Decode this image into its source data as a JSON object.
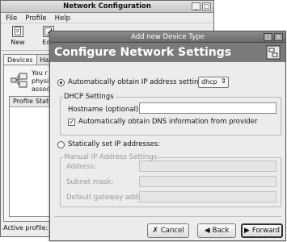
{
  "back_window": {
    "title": "Network Configuration",
    "menu": [
      "File",
      "Profile",
      "Help"
    ],
    "toolbar": [
      {
        "label": "New",
        "icon": "new-icon"
      },
      {
        "label": "Edit",
        "icon": "edit-icon"
      }
    ],
    "tabs": [
      "Devices",
      "Hardw"
    ],
    "info_text": [
      "You r",
      "physi",
      "assoc"
    ],
    "table_headers": [
      "Profile",
      "Status"
    ],
    "status_text": "Active profile: Co"
  },
  "dialog": {
    "window_title": "Add new Device Type",
    "heading": "Configure Network Settings",
    "auto_option": {
      "label": "Automatically obtain IP address settings with:",
      "selected": true
    },
    "protocol_select": {
      "value": "dhcp"
    },
    "dhcp_group": {
      "title": "DHCP Settings",
      "hostname_label": "Hostname (optional):",
      "hostname_value": "",
      "dns_checkbox_label": "Automatically obtain DNS information from provider",
      "dns_checked": true
    },
    "static_option": {
      "label": "Statically set IP addresses:",
      "selected": false
    },
    "manual_group": {
      "title": "Manual IP Address Settings",
      "fields": [
        {
          "label": "Address:",
          "value": ""
        },
        {
          "label": "Subnet mask:",
          "value": ""
        },
        {
          "label": "Default gateway address:",
          "value": ""
        }
      ]
    },
    "buttons": {
      "cancel": "Cancel",
      "back": "Back",
      "forward": "Forward"
    }
  }
}
